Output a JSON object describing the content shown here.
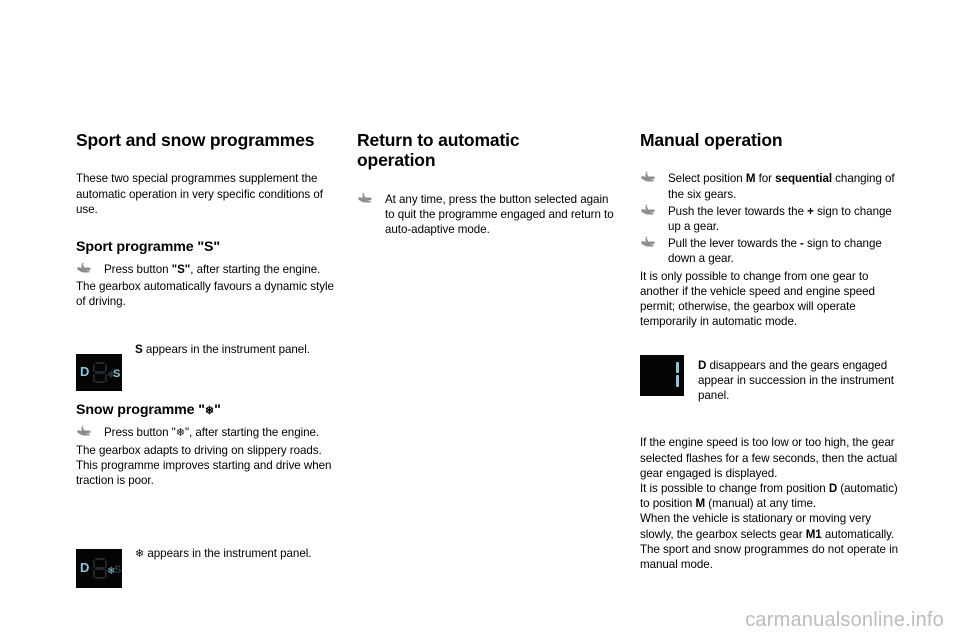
{
  "page": {
    "background": "#ffffff",
    "watermark": "carmanualsonline.info",
    "watermark_color": "#bcbcbc"
  },
  "icons": {
    "bullet": "pointing-hand-icon",
    "bullet_color": "#8d8d8d",
    "snowflake": "❄"
  },
  "columns": {
    "left": {
      "title": "Sport and snow programmes",
      "intro": "These two special programmes supplement the automatic operation in very specific conditions of use.",
      "sport": {
        "heading": "Sport programme \"S\"",
        "bullet": "Press button \"S\", after starting the engine.",
        "bullet_pre": "Press button ",
        "bullet_bold": "\"S\"",
        "bullet_post": ", after starting the engine.",
        "body": "The gearbox automatically favours a dynamic style of driving.",
        "figure_caption_bold": "S",
        "figure_caption_rest": " appears in the instrument panel."
      },
      "snow": {
        "heading_pre": "Snow programme \"",
        "heading_glyph": "❄",
        "heading_post": "\"",
        "bullet_pre": "Press button \"",
        "bullet_glyph": "❄",
        "bullet_post": "\", after starting the engine.",
        "body1": "The gearbox adapts to driving on slippery roads.",
        "body2": "This programme improves starting and drive when traction is poor.",
        "figure_caption_glyph": "❄",
        "figure_caption_rest": " appears in the instrument panel."
      }
    },
    "middle": {
      "title_line1": "Return to automatic",
      "title_line2": "operation",
      "bullet": "At any time, press the button selected again to quit the programme engaged and return to auto-adaptive mode."
    },
    "right": {
      "title": "Manual operation",
      "bullets": [
        {
          "parts": [
            {
              "text": "Select position ",
              "bold": false
            },
            {
              "text": "M",
              "bold": true
            },
            {
              "text": " for ",
              "bold": false
            },
            {
              "text": "sequential",
              "bold": true
            },
            {
              "text": " changing of the six gears.",
              "bold": false
            }
          ]
        },
        {
          "parts": [
            {
              "text": "Push the lever towards the ",
              "bold": false
            },
            {
              "text": "+",
              "bold": true
            },
            {
              "text": " sign to change up a gear.",
              "bold": false
            }
          ]
        },
        {
          "parts": [
            {
              "text": "Pull the lever towards the ",
              "bold": false
            },
            {
              "text": "-",
              "bold": true
            },
            {
              "text": " sign to change down a gear.",
              "bold": false
            }
          ]
        }
      ],
      "paragraph1": "It is only possible to change from one gear to another if the vehicle speed and engine speed permit; otherwise, the gearbox will operate temporarily in automatic mode.",
      "figure_caption_bold": "D",
      "figure_caption_rest": " disappears and the gears engaged appear in succession in the instrument panel.",
      "paragraph2": "If the engine speed is too low or too high, the gear selected flashes for a few seconds, then the actual gear engaged is displayed.",
      "paragraph3_parts": [
        {
          "text": "It is possible to change from position ",
          "bold": false
        },
        {
          "text": "D",
          "bold": true
        },
        {
          "text": " (automatic) to position ",
          "bold": false
        },
        {
          "text": "M",
          "bold": true
        },
        {
          "text": " (manual) at any time.",
          "bold": false
        }
      ],
      "paragraph4_parts": [
        {
          "text": "When the vehicle is stationary or moving very slowly, the gearbox selects gear ",
          "bold": false
        },
        {
          "text": "M1",
          "bold": true
        },
        {
          "text": " automatically.",
          "bold": false
        }
      ],
      "paragraph5": "The sport and snow programmes do not operate in manual mode."
    }
  },
  "figures": {
    "panel_bg": "#050505",
    "lit_color": "#8cc4d9",
    "dim_color": "#23262a",
    "sport_panel": {
      "label_d": "D",
      "label_s": "S",
      "d_state": "lit",
      "s_state": "lit"
    },
    "snow_panel": {
      "label_d": "D",
      "label_s": "S",
      "glyph": "❄",
      "d_state": "lit",
      "s_state": "dim",
      "glyph_state": "lit"
    },
    "manual_panel": {
      "digit": "1",
      "digit_state": "lit"
    }
  }
}
